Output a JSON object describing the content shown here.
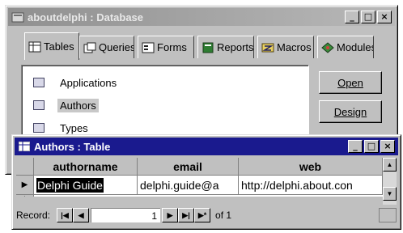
{
  "db_window": {
    "title": "aboutdelphi : Database",
    "sys_buttons": [
      "_",
      "□",
      "×"
    ],
    "tabs": [
      {
        "label": "Tables",
        "icon": "table-icon"
      },
      {
        "label": "Queries",
        "icon": "query-icon"
      },
      {
        "label": "Forms",
        "icon": "form-icon"
      },
      {
        "label": "Reports",
        "icon": "report-icon"
      },
      {
        "label": "Macros",
        "icon": "macro-icon"
      },
      {
        "label": "Modules",
        "icon": "module-icon"
      }
    ],
    "active_tab": "Tables",
    "objects": [
      "Applications",
      "Authors",
      "Types"
    ],
    "selected_object": "Authors",
    "buttons": {
      "open": {
        "label": "Open",
        "mnemonic": "O"
      },
      "design": {
        "label": "Design",
        "mnemonic": "D"
      }
    }
  },
  "table_window": {
    "title": "Authors : Table",
    "sys_buttons": [
      "_",
      "□",
      "×"
    ],
    "columns": [
      "authorname",
      "email",
      "web"
    ],
    "rows": [
      {
        "authorname": "Delphi Guide",
        "email": "delphi.guide@a",
        "web": "http://delphi.about.con"
      }
    ],
    "new_row_marker": "*",
    "current_row_marker": "▶",
    "nav": {
      "label": "Record:",
      "current": "1",
      "of_text": "of 1",
      "first": "|◀",
      "prev": "◀",
      "next": "▶",
      "last": "▶|",
      "new": "▶*"
    }
  },
  "colors": {
    "active_title": "#1a1a8e",
    "face": "#c0c0c0",
    "selection": "#000000"
  }
}
